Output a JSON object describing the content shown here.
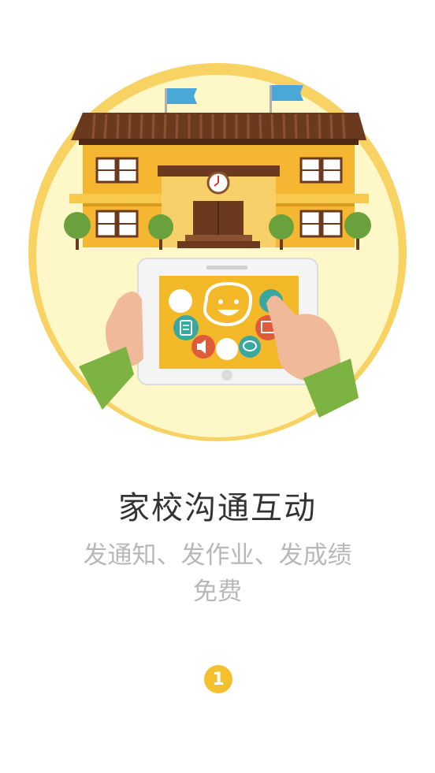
{
  "onboarding": {
    "title": "家校沟通互动",
    "subtitle_line1": "发通知、发作业、发成绩",
    "subtitle_line2": "免费",
    "page_indicator": "1"
  },
  "illustration": {
    "icons": [
      "face-icon",
      "notepad-icon",
      "speaker-icon",
      "chat-icon",
      "image-icon"
    ]
  },
  "colors": {
    "accent": "#f4c02d",
    "circle_outer": "#f8d263",
    "circle_inner": "#fef8c8",
    "building": "#f5b632",
    "roof": "#6b3a1e",
    "sleeve": "#7cb342",
    "title": "#333333",
    "subtitle": "#b8b8b8"
  }
}
